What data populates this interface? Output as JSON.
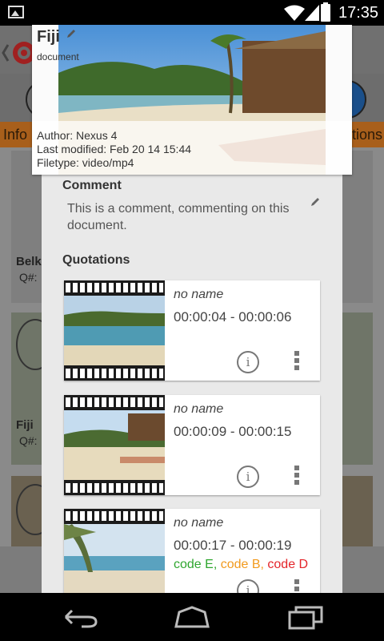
{
  "status_bar": {
    "time": "17:35",
    "icons": [
      "image-icon",
      "wifi-icon",
      "cell-signal-icon",
      "battery-icon"
    ]
  },
  "background": {
    "tab_left": "Info",
    "tab_right": "ations",
    "card1_name": "Belki",
    "card1_q": "Q#:",
    "card2_name": "Fiji",
    "card2_q": "Q#:"
  },
  "header": {
    "title": "Fiji",
    "subtitle": "document",
    "author": "Author: Nexus 4",
    "last_modified": "Last modified: Feb 20 14 15:44",
    "filetype": "Filetype: video/mp4"
  },
  "comment": {
    "heading": "Comment",
    "text": "This is a comment, commenting on this document."
  },
  "quotations": {
    "heading": "Quotations",
    "items": [
      {
        "name": "no name",
        "time": "00:00:04 - 00:00:06",
        "codes": []
      },
      {
        "name": "no name",
        "time": "00:00:09 - 00:00:15",
        "codes": []
      },
      {
        "name": "no name",
        "time": "00:00:17 - 00:00:19",
        "codes": [
          {
            "label": "code E",
            "color": "#2fa62f"
          },
          {
            "label": "code B",
            "color": "#f29a1d"
          },
          {
            "label": "code D",
            "color": "#e4252a"
          }
        ]
      }
    ]
  },
  "navbar": {
    "buttons": [
      "back-icon",
      "home-icon",
      "recent-apps-icon"
    ]
  },
  "colors": {
    "accent_orange": "#a85f1b",
    "code_e": "#2fa62f",
    "code_b": "#f29a1d",
    "code_d": "#e4252a"
  }
}
